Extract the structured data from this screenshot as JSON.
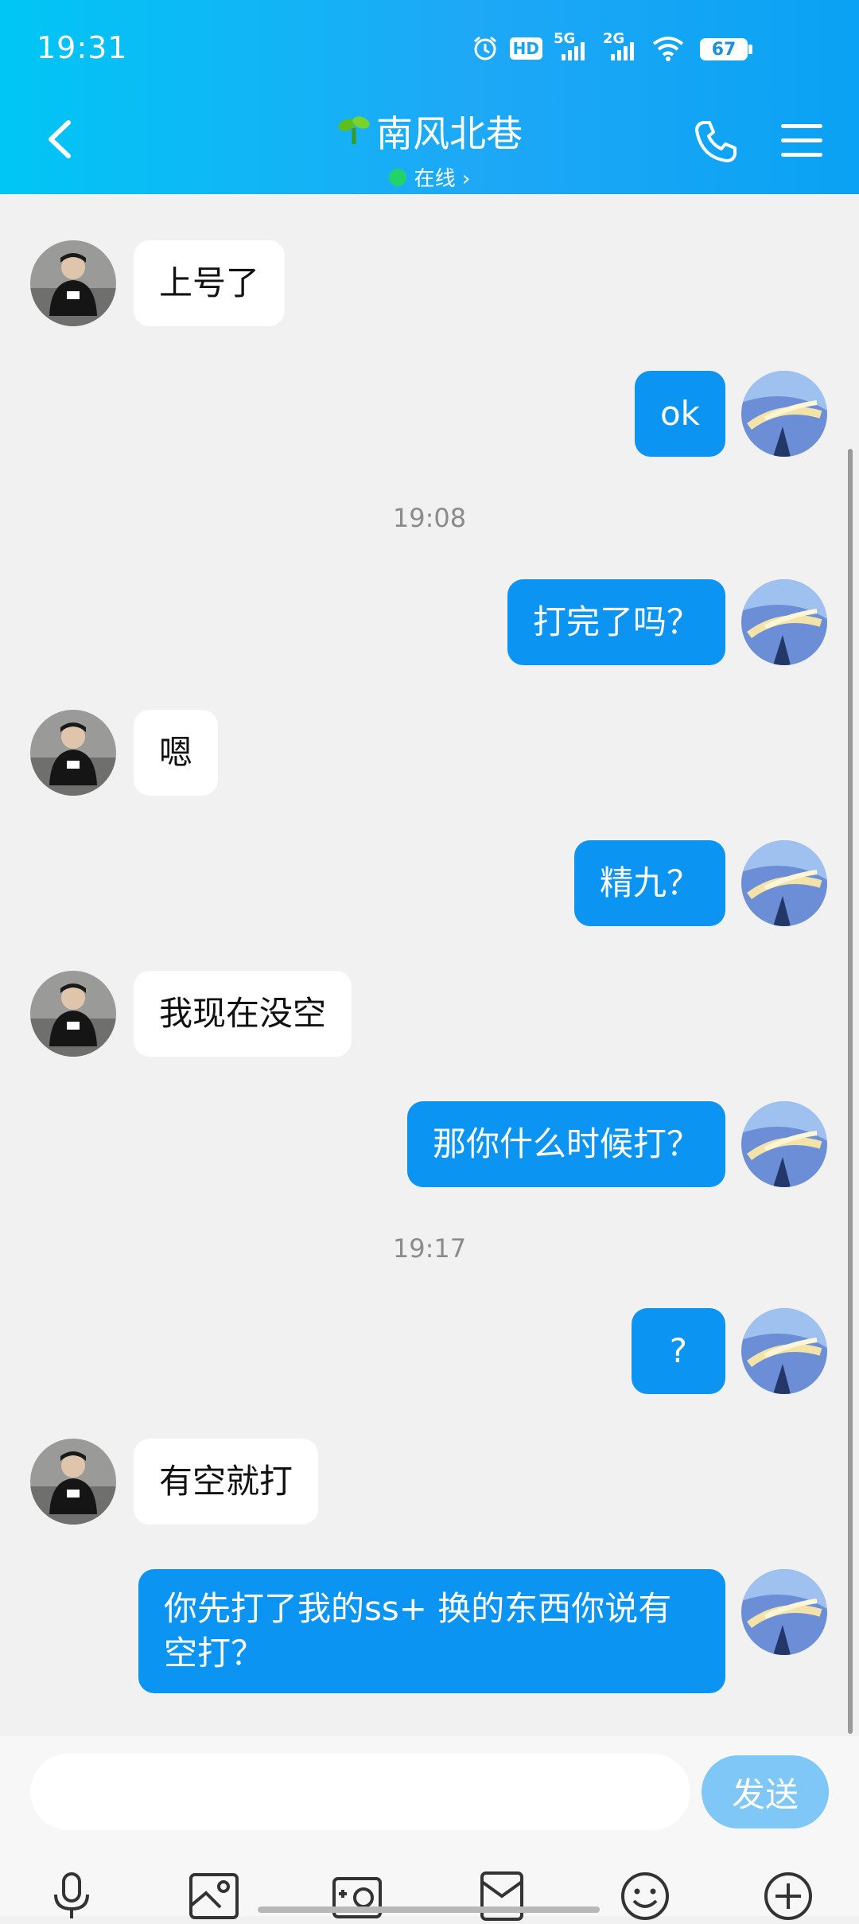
{
  "status_bar": {
    "time": "19:31",
    "network_5g": "5G",
    "network_2g": "2G",
    "hd": "HD",
    "battery": "67"
  },
  "header": {
    "title": "南风北巷",
    "status": "在线 ›"
  },
  "messages": [
    {
      "dir": "in",
      "text": "上号了"
    },
    {
      "dir": "out",
      "text": "ok"
    },
    {
      "type": "timestamp",
      "text": "19:08"
    },
    {
      "dir": "out",
      "text": "打完了吗？"
    },
    {
      "dir": "in",
      "text": "嗯"
    },
    {
      "dir": "out",
      "text": "精九？"
    },
    {
      "dir": "in",
      "text": "我现在没空"
    },
    {
      "dir": "out",
      "text": "那你什么时候打？"
    },
    {
      "type": "timestamp",
      "text": "19:17"
    },
    {
      "dir": "out",
      "text": "?"
    },
    {
      "dir": "in",
      "text": "有空就打"
    },
    {
      "dir": "out",
      "text": "你先打了我的ss+  换的东西你说有空打？"
    }
  ],
  "input": {
    "value": "",
    "placeholder": "",
    "send_label": "发送"
  },
  "colors": {
    "header_start": "#00c6f5",
    "header_end": "#0aa2f4",
    "outgoing_bubble": "#0c94f3",
    "incoming_bubble": "#ffffff",
    "send_button": "#7ec7f6",
    "online": "#22d36a"
  },
  "icons": {
    "toolbar": [
      "microphone-icon",
      "image-icon",
      "camera-icon",
      "red-packet-icon",
      "emoji-icon",
      "plus-icon"
    ]
  }
}
